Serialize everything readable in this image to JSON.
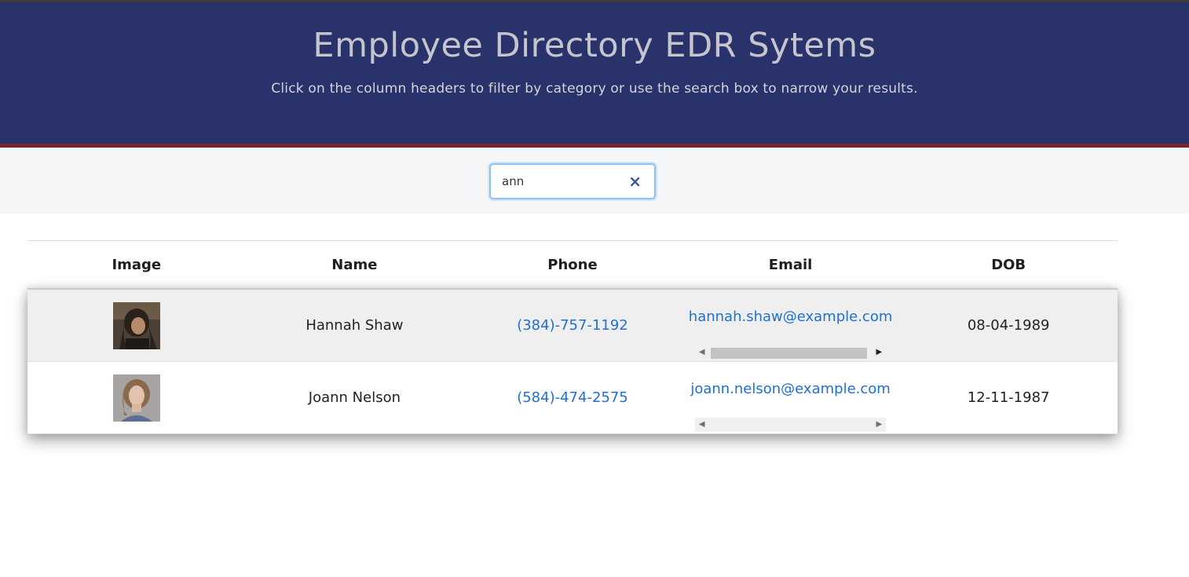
{
  "header": {
    "title": "Employee Directory EDR Sytems",
    "subtitle": "Click on the column headers to filter by category or use the search box to narrow your results."
  },
  "search": {
    "value": "ann",
    "clear_icon": "close-icon",
    "clear_label": "×"
  },
  "table": {
    "columns": [
      "Image",
      "Name",
      "Phone",
      "Email",
      "DOB"
    ],
    "rows": [
      {
        "name": "Hannah Shaw",
        "phone": "(384)-757-1192",
        "email": "hannah.shaw@example.com",
        "dob": "08-04-1989"
      },
      {
        "name": "Joann Nelson",
        "phone": "(584)-474-2575",
        "email": "joann.nelson@example.com",
        "dob": "12-11-1987"
      }
    ]
  },
  "colors": {
    "header_bg": "#2a326b",
    "header_border": "#7b2232",
    "link": "#1f6fd6"
  }
}
